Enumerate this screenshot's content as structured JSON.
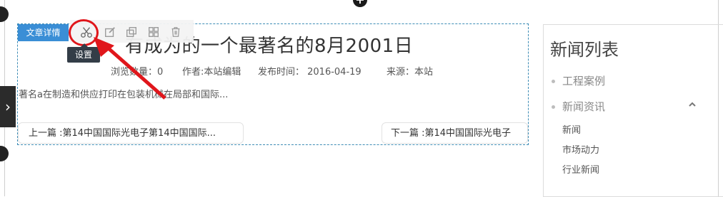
{
  "canvas": {
    "top_handle_icon": "plus-icon",
    "side_tab_icon": "chevron-right-icon"
  },
  "module": {
    "label": "文章详情",
    "toolbar": {
      "icons": [
        "scissors-icon",
        "edit-icon",
        "copy-icon",
        "grid-icon",
        "trash-icon"
      ],
      "tooltip": "设置",
      "highlight_color": "#e0161b",
      "label_color": "#3a8ed6"
    },
    "article": {
      "title": "有成为的一个最著名的8月2001日",
      "views": "浏览数量：0",
      "author": "作者:本站编辑",
      "date": "发布时间： 2016-04-19",
      "source": "来源：本站",
      "summary": "著名a在制造和供应打印在包装机械在局部和国际...",
      "prev": "上一篇 :第14中国国际光电子第14中国国际...",
      "next": "下一篇 :第14中国国际光电子"
    }
  },
  "news_panel": {
    "title": "新闻列表",
    "categories": [
      {
        "label": "工程案例"
      },
      {
        "label": "新闻资讯",
        "expanded": true,
        "children": [
          "新闻",
          "市场动力",
          "行业新闻"
        ]
      }
    ]
  }
}
